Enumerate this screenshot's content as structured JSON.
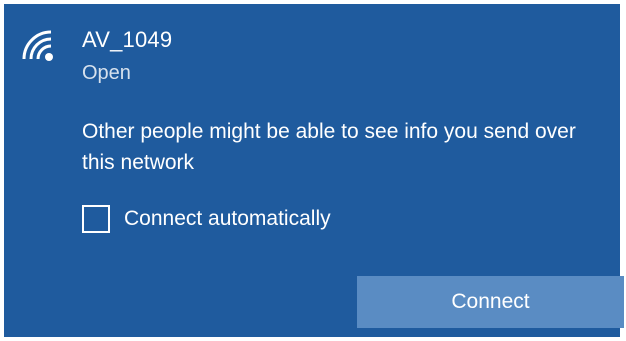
{
  "network": {
    "name": "AV_1049",
    "status": "Open",
    "icon": "wifi-icon"
  },
  "warning": {
    "text": "Other people might be able to see info you send over this network"
  },
  "options": {
    "connect_automatically": {
      "label": "Connect automatically",
      "checked": false
    }
  },
  "actions": {
    "connect_label": "Connect"
  },
  "colors": {
    "panel_bg": "#1f5b9e",
    "button_bg": "#5a8cc3",
    "text": "#ffffff"
  }
}
